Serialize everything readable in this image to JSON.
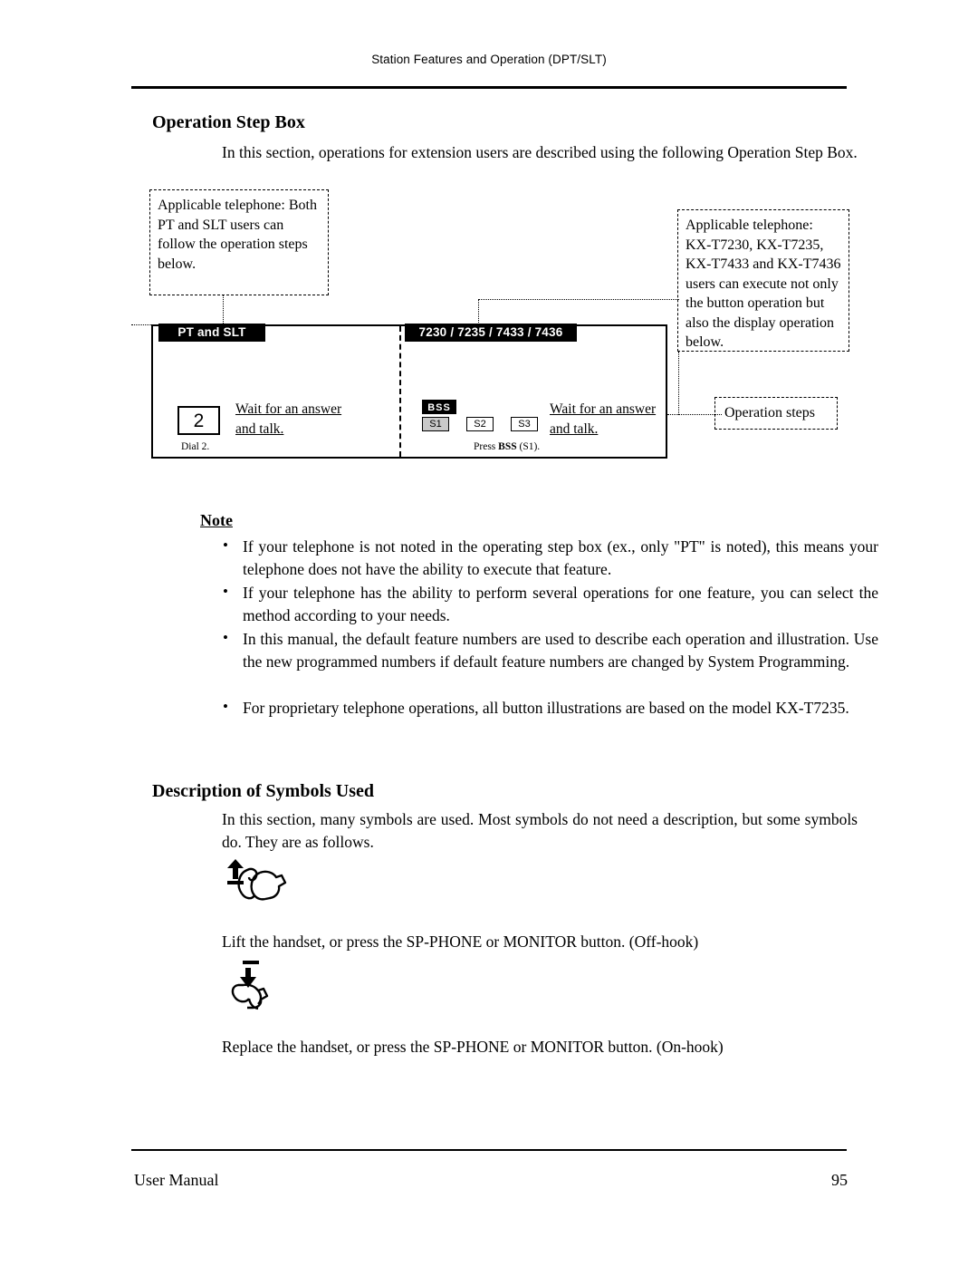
{
  "header": {
    "running_head": "Station Features and Operation (DPT/SLT)"
  },
  "sections": {
    "operation_step_box": {
      "title": "Operation Step Box",
      "intro": "In this section, operations for extension users are described using the following Operation Step Box."
    },
    "description_symbols": {
      "title": "Description of Symbols Used",
      "intro": "In this section, many symbols are used. Most symbols do not need a description, but some symbols do. They are as follows."
    }
  },
  "callouts": {
    "left": "Applicable telephone: Both PT and SLT users can follow the operation steps below.",
    "right": "Applicable telephone: KX-T7230, KX-T7235, KX-T7433 and KX-T7436 users can execute not only the button operation but also the display operation below.",
    "steps": "Operation steps"
  },
  "step_box": {
    "tag_left": "PT and SLT",
    "tag_right": "7230 / 7235 / 7433 / 7436",
    "left_step": {
      "number": "2",
      "text_line1": "Wait for an answer",
      "text_line2": "and talk.",
      "caption": "Dial 2."
    },
    "right_step": {
      "bss_label": "BSS",
      "soft_keys": [
        "S1",
        "S2",
        "S3"
      ],
      "text_line1": "Wait for an answer",
      "text_line2": "and talk.",
      "caption_prefix": "Press ",
      "caption_bold": "BSS",
      "caption_suffix": " (S1)."
    }
  },
  "note": {
    "title": "Note",
    "items": [
      "If your telephone is not noted in the operating step box (ex., only \"PT\" is noted), this means your telephone does not have the ability to execute that feature.",
      "If your telephone has the ability to perform several operations for one feature, you can select the method according to your needs.",
      "In this manual, the default feature numbers are used to describe each operation and illustration. Use the new programmed numbers if default feature numbers are changed by System Programming.",
      "For proprietary telephone operations, all button illustrations are based on the model KX-T7235."
    ],
    "bullet_char": "•"
  },
  "symbols": [
    {
      "icon": "off-hook-handset-icon",
      "caption": "Lift the handset, or press the SP-PHONE or MONITOR button. (Off-hook)"
    },
    {
      "icon": "on-hook-handset-icon",
      "caption": "Replace the handset, or press the SP-PHONE or MONITOR button. (On-hook)"
    }
  ],
  "footer": {
    "left": "User Manual",
    "page_number": "95"
  }
}
